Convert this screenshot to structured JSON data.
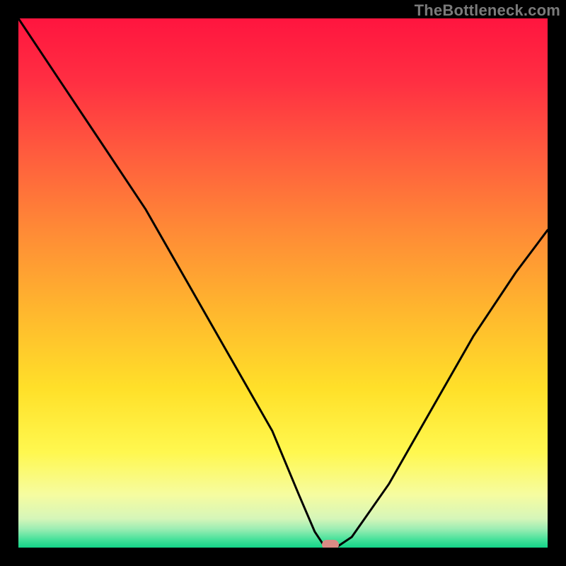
{
  "watermark": "TheBottleneck.com",
  "chart_data": {
    "type": "line",
    "title": "",
    "xlabel": "",
    "ylabel": "",
    "xlim": [
      0,
      100
    ],
    "ylim": [
      0,
      100
    ],
    "series": [
      {
        "name": "bottleneck-curve",
        "x": [
          0,
          8,
          16,
          24,
          32,
          40,
          48,
          53,
          56,
          58,
          60,
          63,
          70,
          78,
          86,
          94,
          100
        ],
        "values": [
          100,
          88,
          76,
          64,
          50,
          36,
          22,
          10,
          3,
          0,
          0,
          2,
          12,
          26,
          40,
          52,
          60
        ]
      }
    ],
    "marker": {
      "x": 59,
      "y": 0
    },
    "background_gradient": {
      "stops": [
        {
          "pos": 0.0,
          "color": "#ff153f"
        },
        {
          "pos": 0.12,
          "color": "#ff2f42"
        },
        {
          "pos": 0.25,
          "color": "#ff5a3e"
        },
        {
          "pos": 0.4,
          "color": "#ff8a36"
        },
        {
          "pos": 0.55,
          "color": "#ffb62e"
        },
        {
          "pos": 0.7,
          "color": "#ffe029"
        },
        {
          "pos": 0.82,
          "color": "#fff84f"
        },
        {
          "pos": 0.9,
          "color": "#f6fca0"
        },
        {
          "pos": 0.945,
          "color": "#d6f6b9"
        },
        {
          "pos": 0.965,
          "color": "#9bedb3"
        },
        {
          "pos": 0.985,
          "color": "#45e19a"
        },
        {
          "pos": 1.0,
          "color": "#14d488"
        }
      ]
    }
  }
}
